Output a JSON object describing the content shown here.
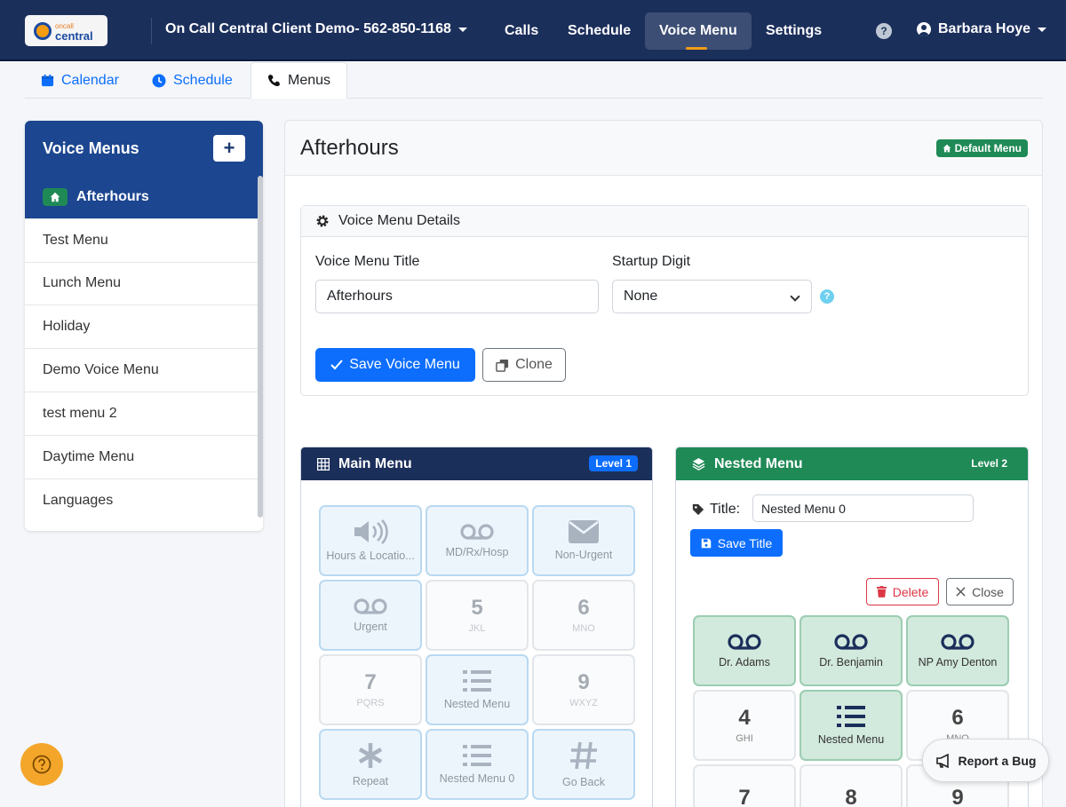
{
  "brand": {
    "logo_top": "oncall",
    "logo_bottom": "central"
  },
  "topnav": {
    "client": "On Call Central Client Demo- 562-850-1168",
    "links": [
      "Calls",
      "Schedule",
      "Voice Menu",
      "Settings"
    ],
    "active": "Voice Menu",
    "help": "?",
    "user": "Barbara Hoye"
  },
  "tabs": [
    {
      "label": "Calendar",
      "icon": "calendar-icon"
    },
    {
      "label": "Schedule",
      "icon": "clock-icon"
    },
    {
      "label": "Menus",
      "icon": "phone-icon"
    }
  ],
  "sidebar": {
    "title": "Voice Menus",
    "add": "+",
    "items": [
      "Afterhours",
      "Test Menu",
      "Lunch Menu",
      "Holiday",
      "Demo Voice Menu",
      "test menu 2",
      "Daytime Menu",
      "Languages"
    ]
  },
  "main": {
    "title": "Afterhours",
    "default_badge": "Default Menu",
    "details": {
      "header": "Voice Menu Details",
      "title_label": "Voice Menu Title",
      "title_value": "Afterhours",
      "digit_label": "Startup Digit",
      "digit_value": "None",
      "help": "?",
      "save": "Save Voice Menu",
      "clone": "Clone"
    }
  },
  "main_menu": {
    "header": "Main Menu",
    "level": "Level 1",
    "keys": [
      {
        "icon": "speaker-icon",
        "caption": "Hours & Locatio..."
      },
      {
        "icon": "voicemail-icon",
        "caption": "MD/Rx/Hosp"
      },
      {
        "icon": "envelope-icon",
        "caption": "Non-Urgent"
      },
      {
        "icon": "voicemail-icon",
        "caption": "Urgent"
      },
      {
        "num": "5",
        "sub": "JKL"
      },
      {
        "num": "6",
        "sub": "MNO"
      },
      {
        "num": "7",
        "sub": "PQRS"
      },
      {
        "icon": "list-icon",
        "caption": "Nested Menu"
      },
      {
        "num": "9",
        "sub": "WXYZ"
      },
      {
        "icon": "asterisk-icon",
        "caption": "Repeat"
      },
      {
        "icon": "list-icon",
        "caption": "Nested Menu 0"
      },
      {
        "icon": "hash-icon",
        "caption": "Go Back"
      }
    ]
  },
  "nested_menu": {
    "header": "Nested Menu",
    "level": "Level 2",
    "title_label": "Title:",
    "title_value": "Nested Menu 0",
    "save_title": "Save Title",
    "delete": "Delete",
    "close": "Close",
    "keys": [
      {
        "icon": "voicemail-icon",
        "caption": "Dr. Adams"
      },
      {
        "icon": "voicemail-icon",
        "caption": "Dr. Benjamin"
      },
      {
        "icon": "voicemail-icon",
        "caption": "NP Amy Denton"
      },
      {
        "num": "4",
        "sub": "GHI"
      },
      {
        "icon": "list-icon",
        "caption": "Nested Menu"
      },
      {
        "num": "6",
        "sub": "MNO"
      },
      {
        "num": "7",
        "sub": ""
      },
      {
        "num": "8",
        "sub": ""
      },
      {
        "num": "9",
        "sub": ""
      }
    ]
  },
  "report_bug": "Report a Bug",
  "colors": {
    "navy": "#1b2f5b",
    "blue": "#0d6efd",
    "green": "#1f8a56",
    "accent": "#f39c12"
  }
}
